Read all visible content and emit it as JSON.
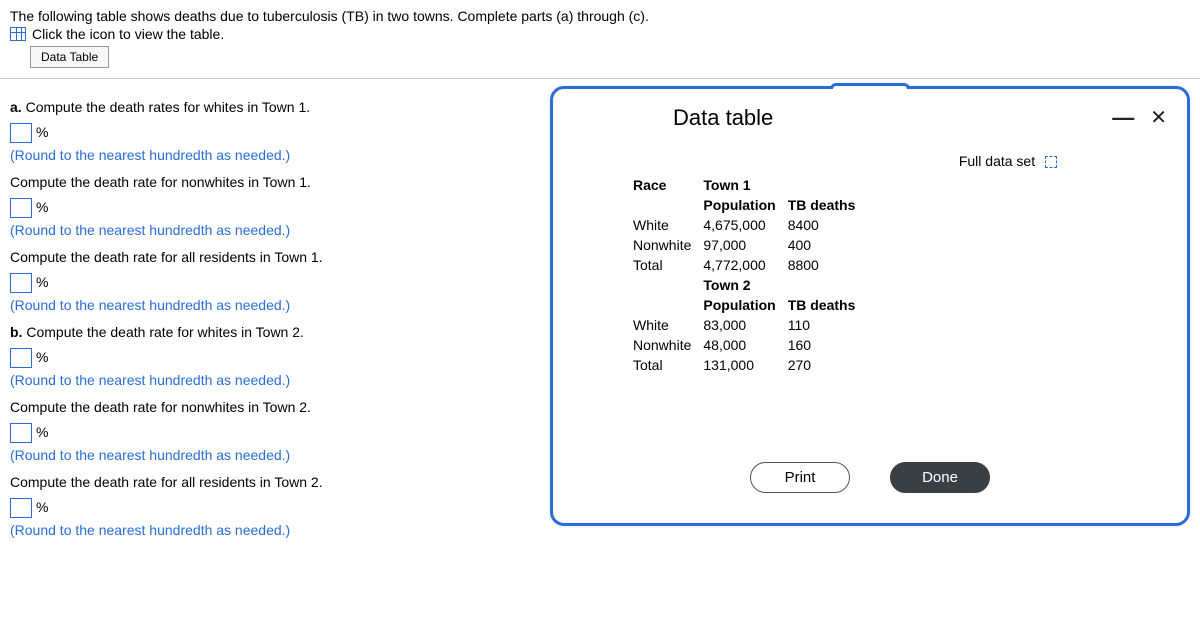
{
  "intro": {
    "line1": "The following table shows deaths due to tuberculosis (TB) in two towns. Complete parts (a) through (c).",
    "icon_line": "Click the icon to view the table.",
    "data_table_btn": "Data Table"
  },
  "questions": {
    "a": {
      "label": "a.",
      "text": "Compute the death rates for whites in Town 1."
    },
    "a_nonwhite": "Compute the death rate for nonwhites in Town 1.",
    "a_all": "Compute the death rate for all residents in Town 1.",
    "b": {
      "label": "b.",
      "text": "Compute the death rate for whites in Town 2."
    },
    "b_nonwhite": "Compute the death rate for nonwhites in Town 2.",
    "b_all": "Compute the death rate for all residents in Town 2.",
    "round_note": "(Round to the nearest hundredth as needed.)",
    "percent": "%"
  },
  "modal": {
    "title": "Data table",
    "full_data_set": "Full data set",
    "print": "Print",
    "done": "Done",
    "headers": {
      "race": "Race",
      "town1": "Town 1",
      "town2": "Town 2",
      "population": "Population",
      "tb_deaths": "TB deaths"
    },
    "rows": {
      "white": "White",
      "nonwhite": "Nonwhite",
      "total": "Total"
    },
    "town1": {
      "white_pop": "4,675,000",
      "white_tb": "8400",
      "nonwhite_pop": "97,000",
      "nonwhite_tb": "400",
      "total_pop": "4,772,000",
      "total_tb": "8800"
    },
    "town2": {
      "white_pop": "83,000",
      "white_tb": "110",
      "nonwhite_pop": "48,000",
      "nonwhite_tb": "160",
      "total_pop": "131,000",
      "total_tb": "270"
    }
  }
}
